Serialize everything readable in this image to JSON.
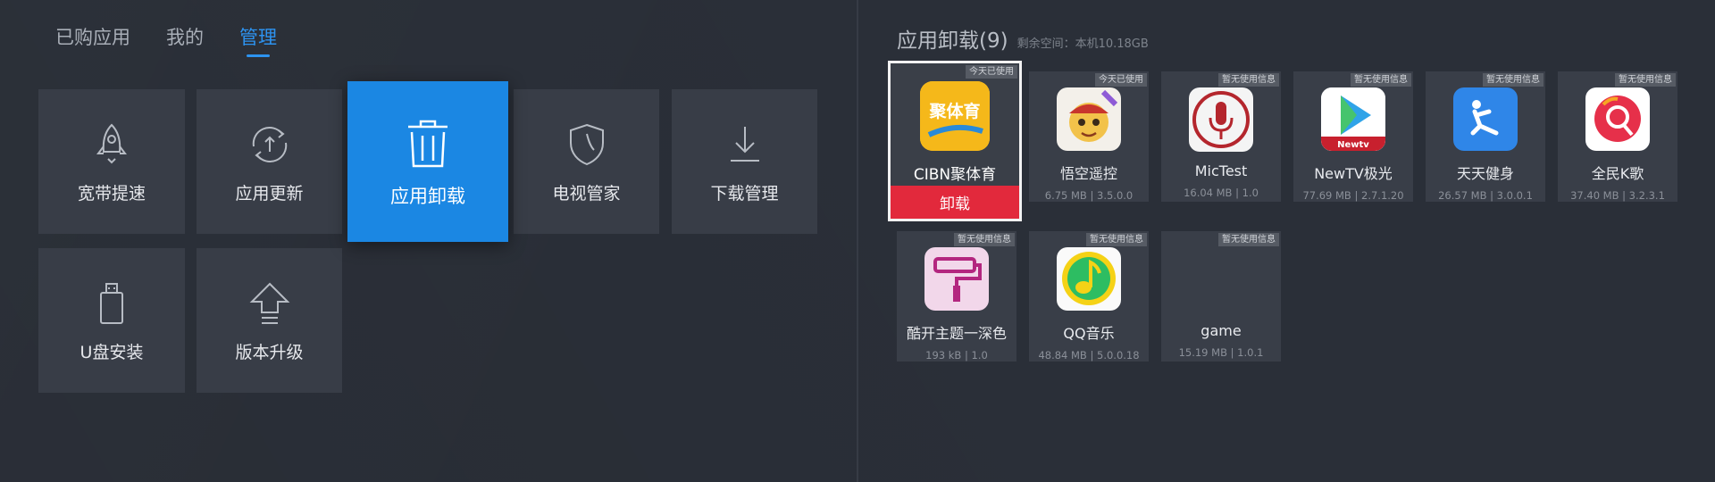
{
  "tabs": [
    {
      "label": "已购应用",
      "active": false
    },
    {
      "label": "我的",
      "active": false
    },
    {
      "label": "管理",
      "active": true
    }
  ],
  "tiles": {
    "broadband": {
      "label": "宽带提速",
      "icon": "rocket-icon"
    },
    "app_update": {
      "label": "应用更新",
      "icon": "refresh-upload-icon"
    },
    "app_uninstall": {
      "label": "应用卸载",
      "icon": "trash-icon"
    },
    "tv_manager": {
      "label": "电视管家",
      "icon": "shield-icon"
    },
    "download_manager": {
      "label": "下载管理",
      "icon": "download-icon"
    },
    "usb_install": {
      "label": "U盘安装",
      "icon": "usb-drive-icon"
    },
    "version_upgrade": {
      "label": "版本升级",
      "icon": "upgrade-arrow-icon"
    }
  },
  "uninstall_panel": {
    "title": "应用卸载(9)",
    "space": "剩余空间：本机10.18GB",
    "uninstall_label": "卸载"
  },
  "apps": [
    {
      "name": "CIBN聚体育",
      "badge": "今天已使用",
      "meta": "",
      "icon": "cibn-sports-icon",
      "icon_text": "聚体育"
    },
    {
      "name": "悟空遥控",
      "badge": "今天已使用",
      "meta": "6.75 MB | 3.5.0.0",
      "icon": "wukong-remote-icon"
    },
    {
      "name": "MicTest",
      "badge": "暂无使用信息",
      "meta": "16.04 MB | 1.0",
      "icon": "microphone-icon"
    },
    {
      "name": "NewTV极光",
      "badge": "暂无使用信息",
      "meta": "77.69 MB | 2.7.1.20",
      "icon": "newtv-play-icon",
      "icon_text": "Newtv"
    },
    {
      "name": "天天健身",
      "badge": "暂无使用信息",
      "meta": "26.57 MB | 3.0.0.1",
      "icon": "fitness-icon"
    },
    {
      "name": "全民K歌",
      "badge": "暂无使用信息",
      "meta": "37.40 MB | 3.2.3.1",
      "icon": "karaoke-icon"
    },
    {
      "name": "酷开主题一深色",
      "badge": "暂无使用信息",
      "meta": "193 kB | 1.0",
      "icon": "paint-roller-icon"
    },
    {
      "name": "QQ音乐",
      "badge": "暂无使用信息",
      "meta": "48.84 MB | 5.0.0.18",
      "icon": "qq-music-icon"
    },
    {
      "name": "game",
      "badge": "暂无使用信息",
      "meta": "15.19 MB | 1.0.1",
      "icon": ""
    }
  ],
  "colors": {
    "background": "#2a2f38",
    "tile": "#383d47",
    "accent": "#1b87e3",
    "tab_active": "#2d93f0",
    "uninstall": "#e2293c"
  }
}
